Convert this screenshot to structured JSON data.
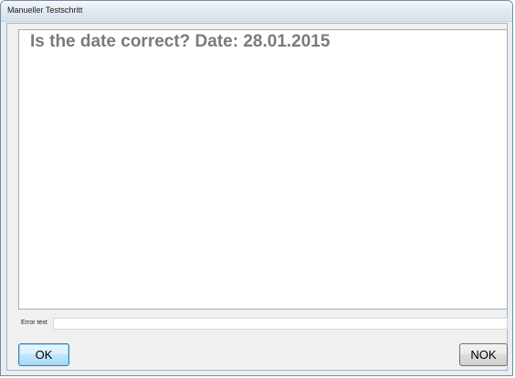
{
  "window": {
    "title": "Manueller Testschritt"
  },
  "message": {
    "text": "Is the date correct? Date: 28.01.2015"
  },
  "error": {
    "label": "Error text",
    "value": "",
    "placeholder": ""
  },
  "buttons": {
    "ok_label": "OK",
    "nok_label": "NOK"
  },
  "colors": {
    "message_text": "#7a7a7a",
    "window_bg": "#e9eef4",
    "ok_focus_border": "#3c7fb1"
  }
}
